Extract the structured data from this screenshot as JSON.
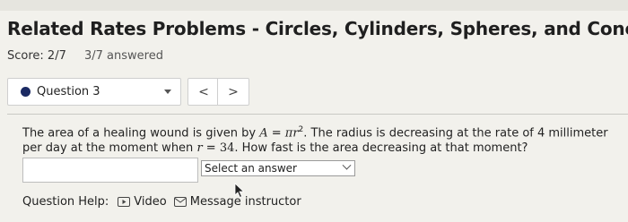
{
  "page": {
    "title": "Related Rates Problems - Circles, Cylinders, Spheres, and Cones",
    "score_label": "Score: 2/7",
    "answered_label": "3/7 answered"
  },
  "question_nav": {
    "current_label": "Question 3",
    "prev_symbol": "<",
    "next_symbol": ">",
    "status_color": "#1b2a63"
  },
  "problem": {
    "text_1": "The area of a healing wound is given by ",
    "formula_lhs": "A",
    "formula_eq": " = ",
    "formula_rhs": "πr",
    "formula_exp": "2",
    "text_2": ". The radius is decreasing at the rate of 4 millimeter per day at the moment when ",
    "var_r": "r",
    "var_eq": " = ",
    "var_value": "34",
    "text_3": ". How fast is the area decreasing at that moment?"
  },
  "answer": {
    "value": "",
    "select_label": "Select an answer"
  },
  "help": {
    "label": "Question Help:",
    "video_label": "Video",
    "message_label": "Message instructor"
  },
  "icons": {
    "video": "video-icon",
    "message": "mail-icon",
    "cursor": "mouse-pointer-icon",
    "dropdown": "caret-down-icon"
  }
}
